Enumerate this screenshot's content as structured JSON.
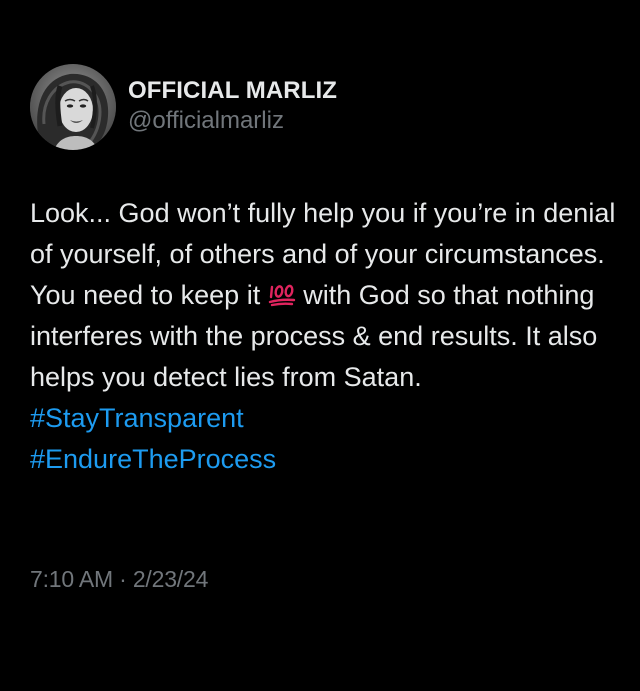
{
  "post": {
    "author": {
      "display_name": "OFFICIAL MARLIZ",
      "handle": "@officialmarliz",
      "avatar": "profile-photo"
    },
    "text_before_emoji": "Look... God won’t fully help you if you’re in denial of yourself, of others and of your circumstances. You need to keep it ",
    "emoji": "hundred-points-icon",
    "text_after_emoji": " with God so that nothing interferes with the process & end results. It also helps you detect lies from Satan.",
    "hashtags": [
      "#StayTransparent",
      "#EndureTheProcess"
    ],
    "timestamp": "7:10 AM · 2/23/24"
  },
  "colors": {
    "background": "#000000",
    "text": "#e7e9ea",
    "secondary_text": "#71767b",
    "hashtag": "#1d9bf0",
    "emoji": "#e0245e"
  }
}
